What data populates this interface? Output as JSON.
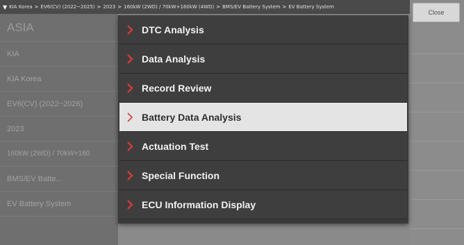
{
  "breadcrumb": {
    "items": [
      "KIA Korea",
      "EV6(CV) (2022~2025)",
      "2023",
      "160kW (2WD) / 70kW+160kW (4WD)",
      "BMS/EV Battery System",
      "EV Battery System"
    ]
  },
  "close_label": "Close",
  "left_list": [
    "ASIA",
    "KIA",
    "KIA Korea",
    "EV6(CV) (2022~2026)",
    "2023",
    "160kW (2WD) / 70kW+160",
    "BMS/EV Batte...",
    "EV Battery System"
  ],
  "menu": {
    "items": [
      "DTC Analysis",
      "Data Analysis",
      "Record Review",
      "Battery Data Analysis",
      "Actuation Test",
      "Special Function",
      "ECU Information Display"
    ],
    "selected_index": 3
  },
  "colors": {
    "chevron": "#d23a3a",
    "selected_bg": "#e4e4e4",
    "menu_bg": "#3e3e3e"
  }
}
